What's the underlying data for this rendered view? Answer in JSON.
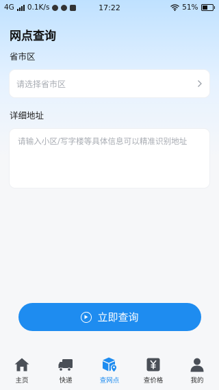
{
  "status_bar": {
    "network": "4G",
    "speed": "0.1K/s",
    "time": "17:22",
    "battery": "51%"
  },
  "page": {
    "title": "网点查询"
  },
  "region": {
    "label": "省市区",
    "placeholder": "请选择省市区"
  },
  "address": {
    "label": "详细地址",
    "placeholder": "请输入小区/写字楼等具体信息可以精准识别地址"
  },
  "action": {
    "query_label": "立即查询"
  },
  "tab_bar": {
    "active_index": 2,
    "accent_color": "#1e8cf0",
    "items": [
      {
        "label": "主页",
        "icon": "home-icon"
      },
      {
        "label": "快递",
        "icon": "truck-icon"
      },
      {
        "label": "查网点",
        "icon": "box-location-icon"
      },
      {
        "label": "查价格",
        "icon": "price-tag-icon"
      },
      {
        "label": "我的",
        "icon": "person-icon"
      }
    ]
  }
}
